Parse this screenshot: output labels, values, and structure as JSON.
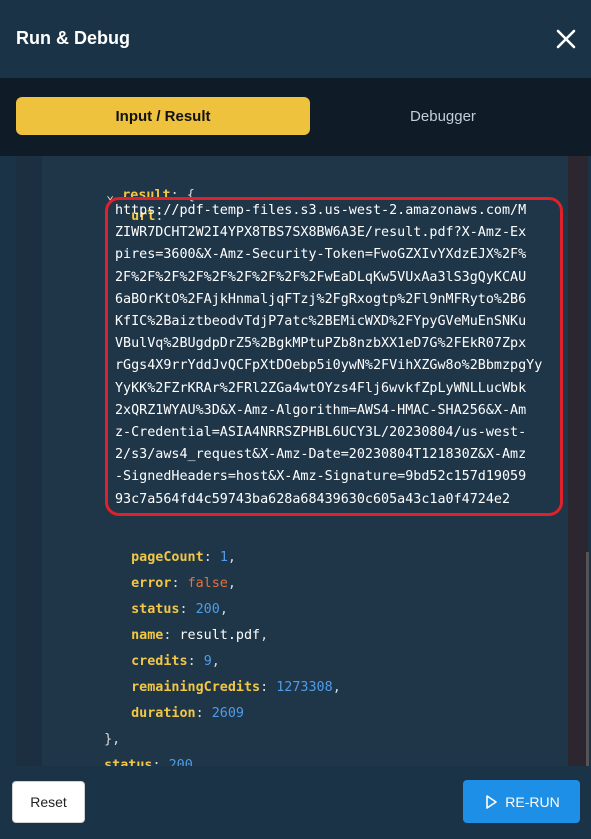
{
  "header": {
    "title": "Run & Debug",
    "close_icon": "close-icon"
  },
  "tabs": [
    {
      "label": "Input / Result",
      "active": true
    },
    {
      "label": "Debugger",
      "active": false
    }
  ],
  "code": {
    "result_key": "result",
    "url_key": "url",
    "url_lines": [
      "https://pdf-temp-files.s3.us-west-2.amazonaws.com/M",
      "ZIWR7DCHT2W2I4YPX8TBS7SX8BW6A3E/result.pdf?X-Amz-Ex",
      "pires=3600&X-Amz-Security-Token=FwoGZXIvYXdzEJX%2F%",
      "2F%2F%2F%2F%2F%2F%2F%2F%2FwEaDLqKw5VUxAa3lS3gQyKCAU",
      "6aBOrKtO%2FAjkHnmaljqFTzj%2FgRxogtp%2Fl9nMFRyto%2B6",
      "KfIC%2BaiztbeodvTdjP7atc%2BEMicWXD%2FYpyGVeMuEnSNKu",
      "VBulVq%2BUgdpDrZ5%2BgkMPtuPZb8nzbXX1eD7G%2FEkR07Zpx",
      "rGgs4X9rrYddJvQCFpXtDOebp5i0ywN%2FVihXZGw8o%2BbmzpgYy",
      "YyKK%2FZrKRAr%2FRl2ZGa4wtOYzs4Flj6wvkfZpLyWNLLucWbk",
      "2xQRZ1WYAU%3D&X-Amz-Algorithm=AWS4-HMAC-SHA256&X-Am",
      "z-Credential=ASIA4NRRSZPHBL6UCY3L/20230804/us-west-",
      "2/s3/aws4_request&X-Amz-Date=20230804T121830Z&X-Amz",
      "-SignedHeaders=host&X-Amz-Signature=9bd52c157d19059",
      "93c7a564fd4c59743ba628a68439630c605a43c1a0f4724e2"
    ],
    "page_count_key": "pageCount",
    "page_count": "1",
    "error_key": "error",
    "error_value": "false",
    "status_key": "status",
    "status_value": "200",
    "name_key": "name",
    "name_value": "result.pdf",
    "credits_key": "credits",
    "credits_value": "9",
    "remaining_key": "remainingCredits",
    "remaining_value": "1273308",
    "duration_key": "duration",
    "duration_value": "2609",
    "outer_status_key": "status",
    "outer_status_value": "200"
  },
  "footer": {
    "reset_label": "Reset",
    "rerun_label": "RE-RUN",
    "rerun_icon": "play-icon"
  }
}
